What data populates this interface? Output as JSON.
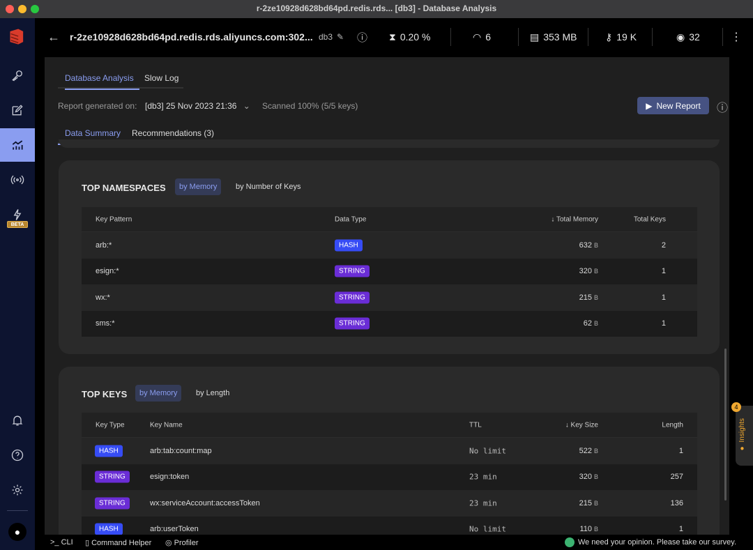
{
  "window": {
    "title": "r-2ze10928d628bd64pd.redis.rds... [db3] - Database Analysis"
  },
  "sidebar": {
    "items": [
      {
        "icon": "key-icon"
      },
      {
        "icon": "workbench-icon"
      },
      {
        "icon": "analytics-icon",
        "active": true
      },
      {
        "icon": "pubsub-icon"
      },
      {
        "icon": "triggers-icon",
        "badge": "BETA"
      }
    ],
    "bottom": [
      {
        "icon": "bell-icon"
      },
      {
        "icon": "help-icon"
      },
      {
        "icon": "settings-icon"
      },
      {
        "icon": "github-icon"
      }
    ]
  },
  "header": {
    "host": "r-2ze10928d628bd64pd.redis.rds.aliyuncs.com:302...",
    "db": "db3",
    "cpu": "0.20 %",
    "ops": "6",
    "memory": "353 MB",
    "keys": "19 K",
    "clients": "32"
  },
  "tabs": [
    "Database Analysis",
    "Slow Log"
  ],
  "report": {
    "label": "Report generated on:",
    "selected": "[db3] 25 Nov 2023 21:36",
    "scanned": "Scanned 100% (5/5 keys)",
    "new_report": "New Report"
  },
  "subtabs": [
    "Data Summary",
    "Recommendations (3)"
  ],
  "namespaces": {
    "title": "TOP NAMESPACES",
    "toggles": [
      "by Memory",
      "by Number of Keys"
    ],
    "columns": [
      "Key Pattern",
      "Data Type",
      "Total Memory",
      "Total Keys"
    ],
    "rows": [
      {
        "pattern": "arb:*",
        "type": "HASH",
        "memory": "632",
        "unit": "B",
        "keys": "2"
      },
      {
        "pattern": "esign:*",
        "type": "STRING",
        "memory": "320",
        "unit": "B",
        "keys": "1"
      },
      {
        "pattern": "wx:*",
        "type": "STRING",
        "memory": "215",
        "unit": "B",
        "keys": "1"
      },
      {
        "pattern": "sms:*",
        "type": "STRING",
        "memory": "62",
        "unit": "B",
        "keys": "1"
      }
    ]
  },
  "topkeys": {
    "title": "TOP KEYS",
    "toggles": [
      "by Memory",
      "by Length"
    ],
    "columns": [
      "Key Type",
      "Key Name",
      "TTL",
      "Key Size",
      "Length"
    ],
    "rows": [
      {
        "type": "HASH",
        "name": "arb:tab:count:map",
        "ttl": "No limit",
        "size": "522",
        "unit": "B",
        "length": "1"
      },
      {
        "type": "STRING",
        "name": "esign:token",
        "ttl": "23 min",
        "size": "320",
        "unit": "B",
        "length": "257"
      },
      {
        "type": "STRING",
        "name": "wx:serviceAccount:accessToken",
        "ttl": "23 min",
        "size": "215",
        "unit": "B",
        "length": "136"
      },
      {
        "type": "HASH",
        "name": "arb:userToken",
        "ttl": "No limit",
        "size": "110",
        "unit": "B",
        "length": "1"
      }
    ]
  },
  "insights": {
    "label": "Insights",
    "count": "4"
  },
  "bottombar": {
    "cli": "CLI",
    "helper": "Command Helper",
    "profiler": "Profiler",
    "survey": "We need your opinion. Please take our survey."
  },
  "colors": {
    "accent": "#8a9df0",
    "hash": "#364cf5",
    "string": "#6a2dd6",
    "sidebar": "#0d1430"
  }
}
